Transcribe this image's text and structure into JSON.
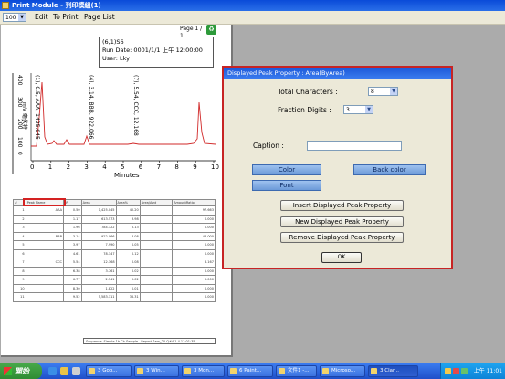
{
  "window": {
    "title": "Print Module - 列印模組(1)"
  },
  "menubar": {
    "zoom_value": "100",
    "edit": "Edit",
    "to_print": "To Print",
    "page_list": "Page List"
  },
  "report": {
    "page_badge": "Page 1 / 1",
    "info_lines": [
      "(6,1)S6",
      "Run  Date:  0001/1/1  上午 12:00:00",
      "User: Lky"
    ],
    "y_axis_label": "mV 毫伏特",
    "y_ticks": [
      "400",
      "300",
      "200",
      "100",
      "0"
    ],
    "x_ticks": [
      "0",
      "1",
      "2",
      "3",
      "4",
      "5",
      "6",
      "7",
      "8",
      "9",
      "10"
    ],
    "x_axis_label": "Minutes",
    "peak_labels": [
      "(1), 0.5, AAA, 1425.045",
      "(4), 3.14, BBB, 922.066",
      "(7), 5.54, CCC, 12.168"
    ],
    "table_headers": [
      "#",
      "Peak Name",
      "tR",
      "Area",
      "Area%",
      "Area/Amt",
      "AmountRatio"
    ],
    "table_rows": [
      [
        "1",
        "AAA",
        "0.50",
        "1,425.045",
        "40.20",
        "",
        "97.663"
      ],
      [
        "2",
        "",
        "1.17",
        "613.573",
        "3.98",
        "",
        "0.000"
      ],
      [
        "3",
        "",
        "1.96",
        "784.122",
        "5.13",
        "",
        "0.000"
      ],
      [
        "4",
        "BBB",
        "3.14",
        "922.066",
        "6.08",
        "",
        "48.000"
      ],
      [
        "5",
        "",
        "3.97",
        "7.990",
        "0.05",
        "",
        "0.000"
      ],
      [
        "6",
        "",
        "4.61",
        "78.147",
        "0.12",
        "",
        "0.000"
      ],
      [
        "7",
        "CCC",
        "5.54",
        "12.168",
        "0.08",
        "",
        "8.167"
      ],
      [
        "8",
        "",
        "6.38",
        "3.761",
        "0.02",
        "",
        "0.000"
      ],
      [
        "9",
        "",
        "6.77",
        "2.541",
        "0.02",
        "",
        "0.000"
      ],
      [
        "10",
        "",
        "8.30",
        "1.822",
        "0.01",
        "",
        "0.000"
      ],
      [
        "11",
        "",
        "9.52",
        "5,583.111",
        "36.31",
        "",
        "0.000"
      ]
    ],
    "footer_text": "Sequence: Simple 1b.Ch.Sample...Report.Sam_20 Q#4   1.4   11:01:35"
  },
  "dialog": {
    "title": "Displayed Peak Property : Area(ByArea)",
    "total_characters_label": "Total Characters :",
    "total_characters_value": "8",
    "fraction_digits_label": "Fraction Digits :",
    "fraction_digits_value": "3",
    "caption_label": "Caption :",
    "caption_value": "",
    "color_button": "Color",
    "back_color_button": "Back color",
    "font_button": "Font",
    "insert_button": "Insert Displayed Peak Property",
    "new_button": "New Displayed Peak Property",
    "remove_button": "Remove Displayed Peak Property",
    "ok_button": "OK"
  },
  "taskbar": {
    "start_label": "開始",
    "buttons": [
      "3 Goo...",
      "3 Win...",
      "3 Mon...",
      "6 Paint...",
      "文件1 -...",
      "Microso...",
      "3 Clar..."
    ],
    "clock": "上午 11:01"
  }
}
